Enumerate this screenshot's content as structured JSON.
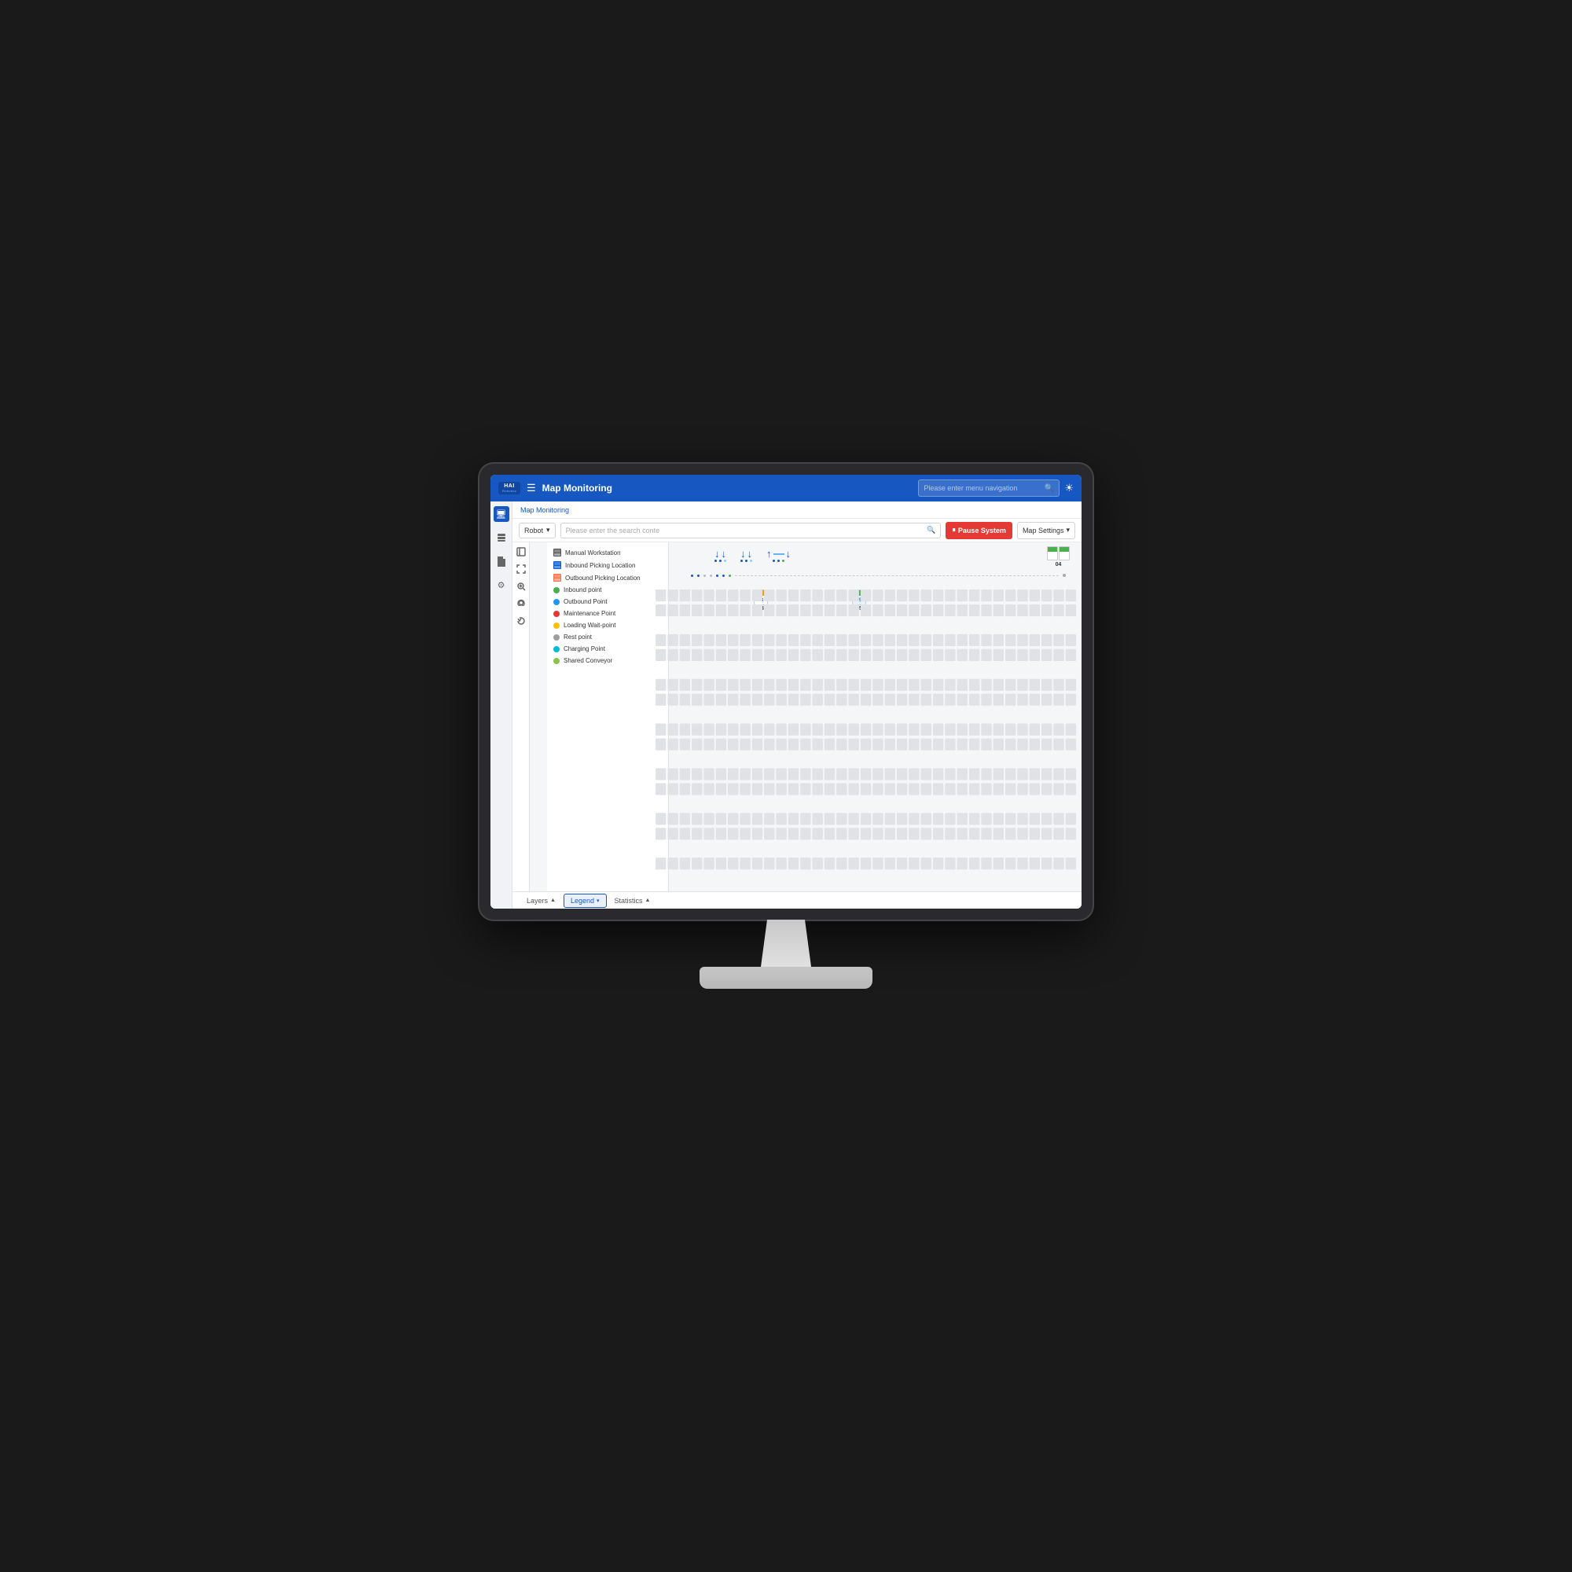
{
  "monitor": {
    "title": "Monitor display"
  },
  "nav": {
    "logo_hai": "HAI",
    "logo_sub": "Robotics",
    "menu_icon": "☰",
    "title": "Map Monitoring",
    "search_placeholder": "Please enter menu navigation",
    "sun_icon": "☀"
  },
  "breadcrumb": {
    "text": "Map Monitoring"
  },
  "toolbar": {
    "robot_label": "Robot",
    "search_placeholder": "Please enter the search conte",
    "pause_label": "Pause System",
    "pause_icon": "⏸",
    "map_settings_label": "Map Settings",
    "map_settings_arrow": "▾"
  },
  "map_tools": [
    {
      "name": "map-tool",
      "icon": "⊞"
    },
    {
      "name": "map-tool",
      "icon": "⤢"
    },
    {
      "name": "map-tool",
      "icon": "⊕"
    },
    {
      "name": "map-tool",
      "icon": "▣"
    },
    {
      "name": "map-tool",
      "icon": "↩"
    }
  ],
  "legend": {
    "title": "Legend",
    "items": [
      {
        "type": "icon",
        "color": "#555",
        "label": "Manual Workstation"
      },
      {
        "type": "icon",
        "color": "#1757c2",
        "label": "Inbound Picking Location"
      },
      {
        "type": "icon",
        "color": "#ff7043",
        "label": "Outbound Picking Location"
      },
      {
        "type": "dot",
        "color": "#4caf50",
        "label": "Inbound point"
      },
      {
        "type": "dot",
        "color": "#2196f3",
        "label": "Outbound Point"
      },
      {
        "type": "dot",
        "color": "#e53935",
        "label": "Maintenance Point"
      },
      {
        "type": "dot",
        "color": "#ffc107",
        "label": "Loading Wait-point"
      },
      {
        "type": "dot",
        "color": "#9e9e9e",
        "label": "Rest point"
      },
      {
        "type": "dot",
        "color": "#00bcd4",
        "label": "Charging Point"
      },
      {
        "type": "dot",
        "color": "#8bc34a",
        "label": "Shared Conveyor"
      }
    ]
  },
  "bottom_tabs": [
    {
      "label": "Layers",
      "arrow": "▲",
      "active": false
    },
    {
      "label": "Legend",
      "arrow": "▾",
      "active": true
    },
    {
      "label": "Statistics",
      "arrow": "▲",
      "active": false
    }
  ],
  "robots": [
    {
      "id": "03",
      "top_color": "#ff9800",
      "bottom_color": "#fff",
      "label": "03"
    },
    {
      "id": "05",
      "top_color": "#4caf50",
      "bottom_color": "#e3f2fd",
      "label": "05"
    },
    {
      "id": "04",
      "top_color": "#4caf50",
      "bottom_color": "#fff",
      "label": "04"
    }
  ],
  "sidebar_icons": [
    {
      "name": "monitor-icon",
      "icon": "🖥",
      "active": true
    },
    {
      "name": "database-icon",
      "icon": "◫",
      "active": false
    },
    {
      "name": "document-icon",
      "icon": "📄",
      "active": false
    },
    {
      "name": "settings-icon",
      "icon": "⚙",
      "active": false
    }
  ]
}
